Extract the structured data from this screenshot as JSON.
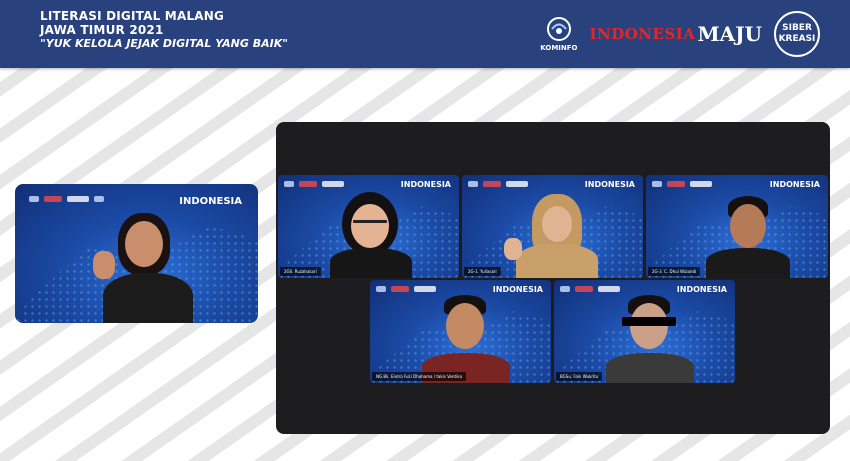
{
  "banner": {
    "line1": "LITERASI DIGITAL MALANG",
    "line2": "JAWA TIMUR 2021",
    "line3": "\"YUK KELOLA JEJAK DIGITAL YANG BAIK\"",
    "logos": {
      "kominfo_label": "KOMINFO",
      "indonesia": "INDONESIA",
      "maju": "MAJU",
      "siber_line1": "SIBER",
      "siber_line2": "KREASI"
    }
  },
  "tile_badge": {
    "title": "INDONESIA"
  },
  "presenter": {
    "color_bg": "#1b4aa5"
  },
  "participants": [
    {
      "label": "2G0. Ruzahasari"
    },
    {
      "label": "2G-1. Yuliasari"
    },
    {
      "label": "2G-3. C. Dhui Wulandi"
    },
    {
      "label": "NG.Bk. Endra Fuzi Dhahama / takis Ventika"
    },
    {
      "label": "BGSu. Fani Wukritu"
    }
  ],
  "colors": {
    "banner": "#29427d",
    "gallery": "#1d1d1f",
    "accent_red": "#e2262b"
  }
}
